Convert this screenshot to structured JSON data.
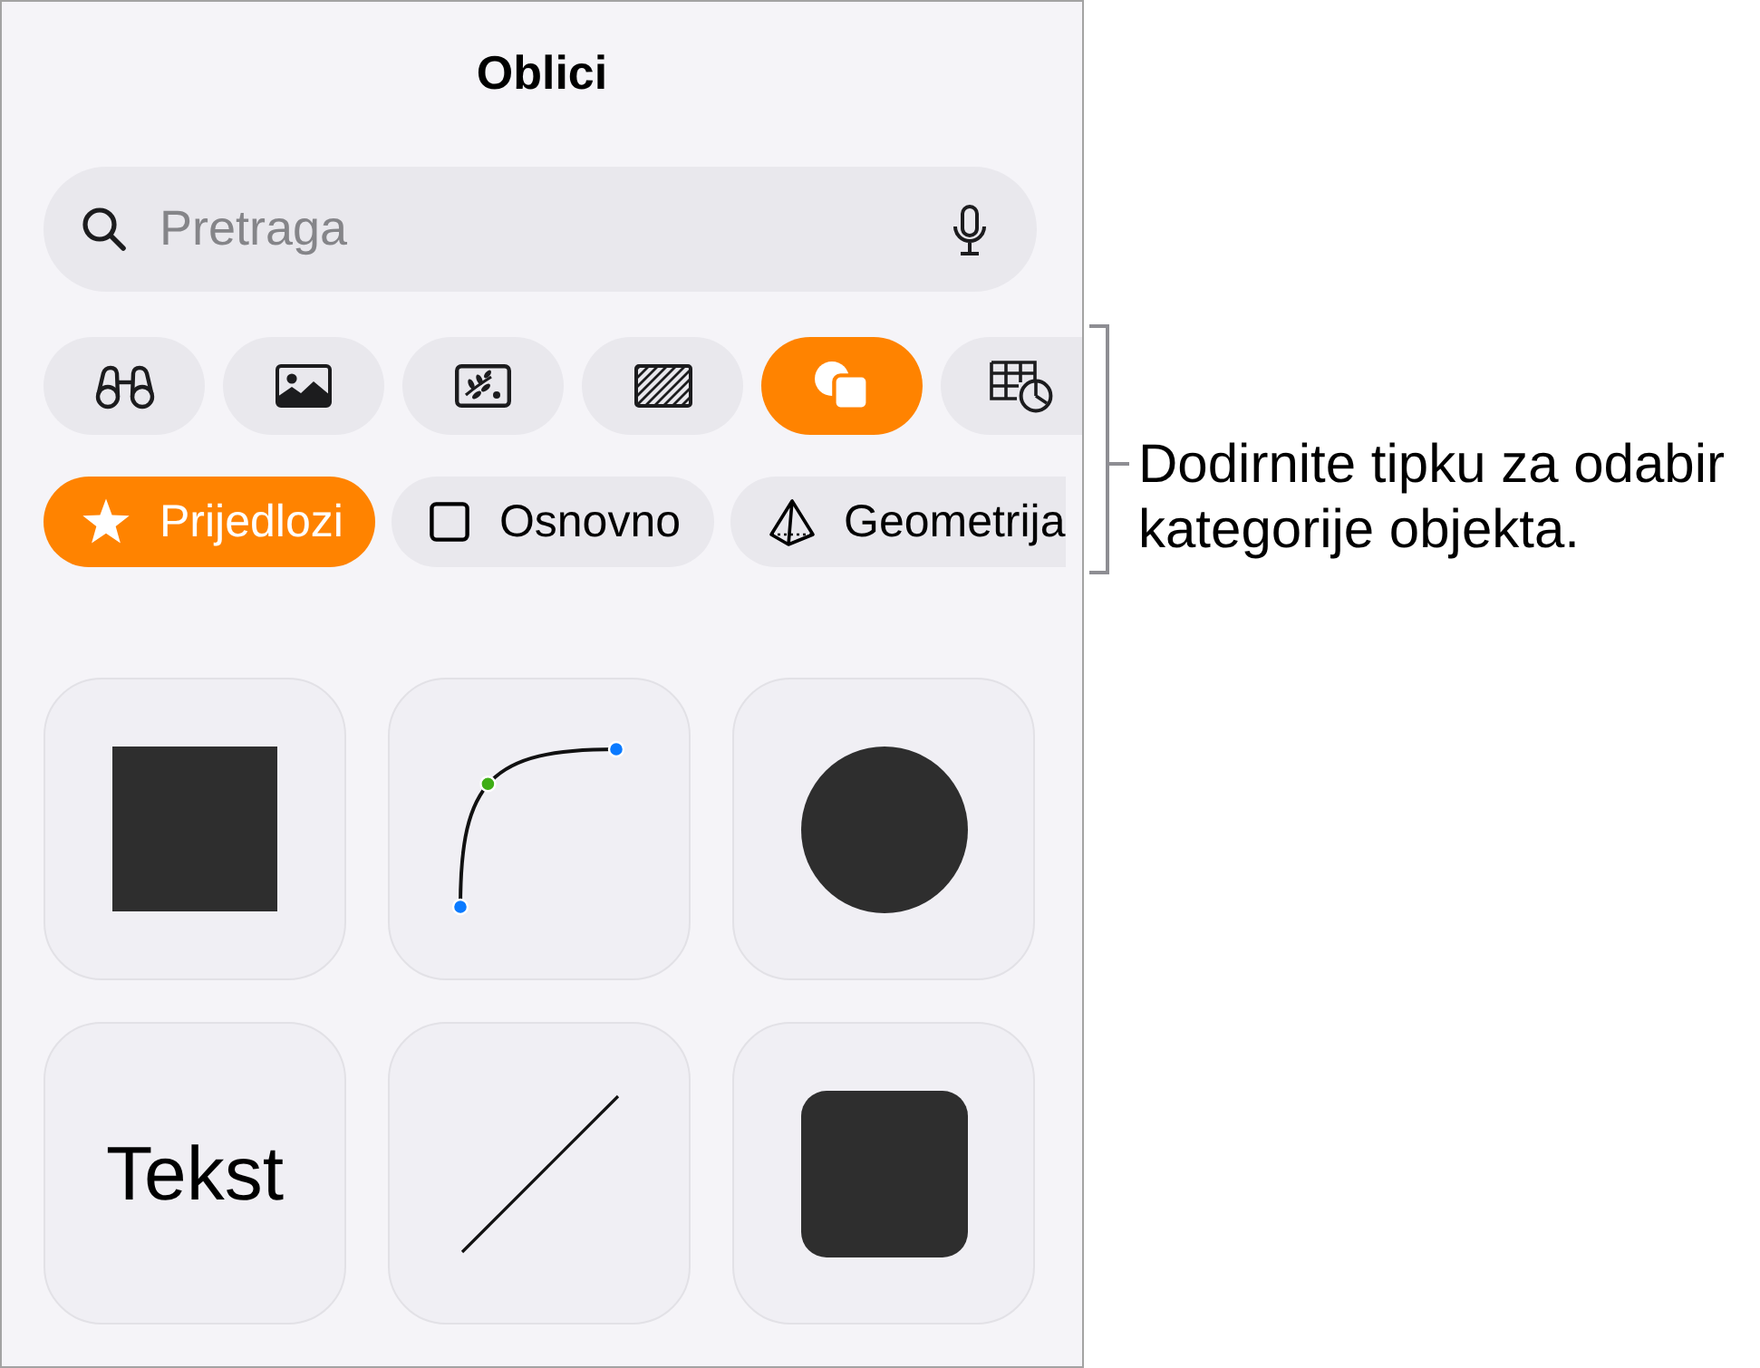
{
  "panel": {
    "title": "Oblici"
  },
  "search": {
    "placeholder": "Pretraga"
  },
  "object_types": [
    {
      "kind": "binoculars",
      "selected": false
    },
    {
      "kind": "image",
      "selected": false
    },
    {
      "kind": "sticker",
      "selected": false
    },
    {
      "kind": "pattern",
      "selected": false
    },
    {
      "kind": "shapes",
      "selected": true
    },
    {
      "kind": "table-chart",
      "selected": false
    }
  ],
  "categories": [
    {
      "kind": "star",
      "label": "Prijedlozi",
      "selected": true
    },
    {
      "kind": "square",
      "label": "Osnovno",
      "selected": false
    },
    {
      "kind": "pyramid",
      "label": "Geometrija",
      "selected": false
    }
  ],
  "shapes": [
    {
      "kind": "square"
    },
    {
      "kind": "curve"
    },
    {
      "kind": "circle"
    },
    {
      "kind": "text",
      "label": "Tekst"
    },
    {
      "kind": "line"
    },
    {
      "kind": "rounded-square"
    }
  ],
  "callout": {
    "text": "Dodirnite tipku za odabir kategorije objekta."
  }
}
